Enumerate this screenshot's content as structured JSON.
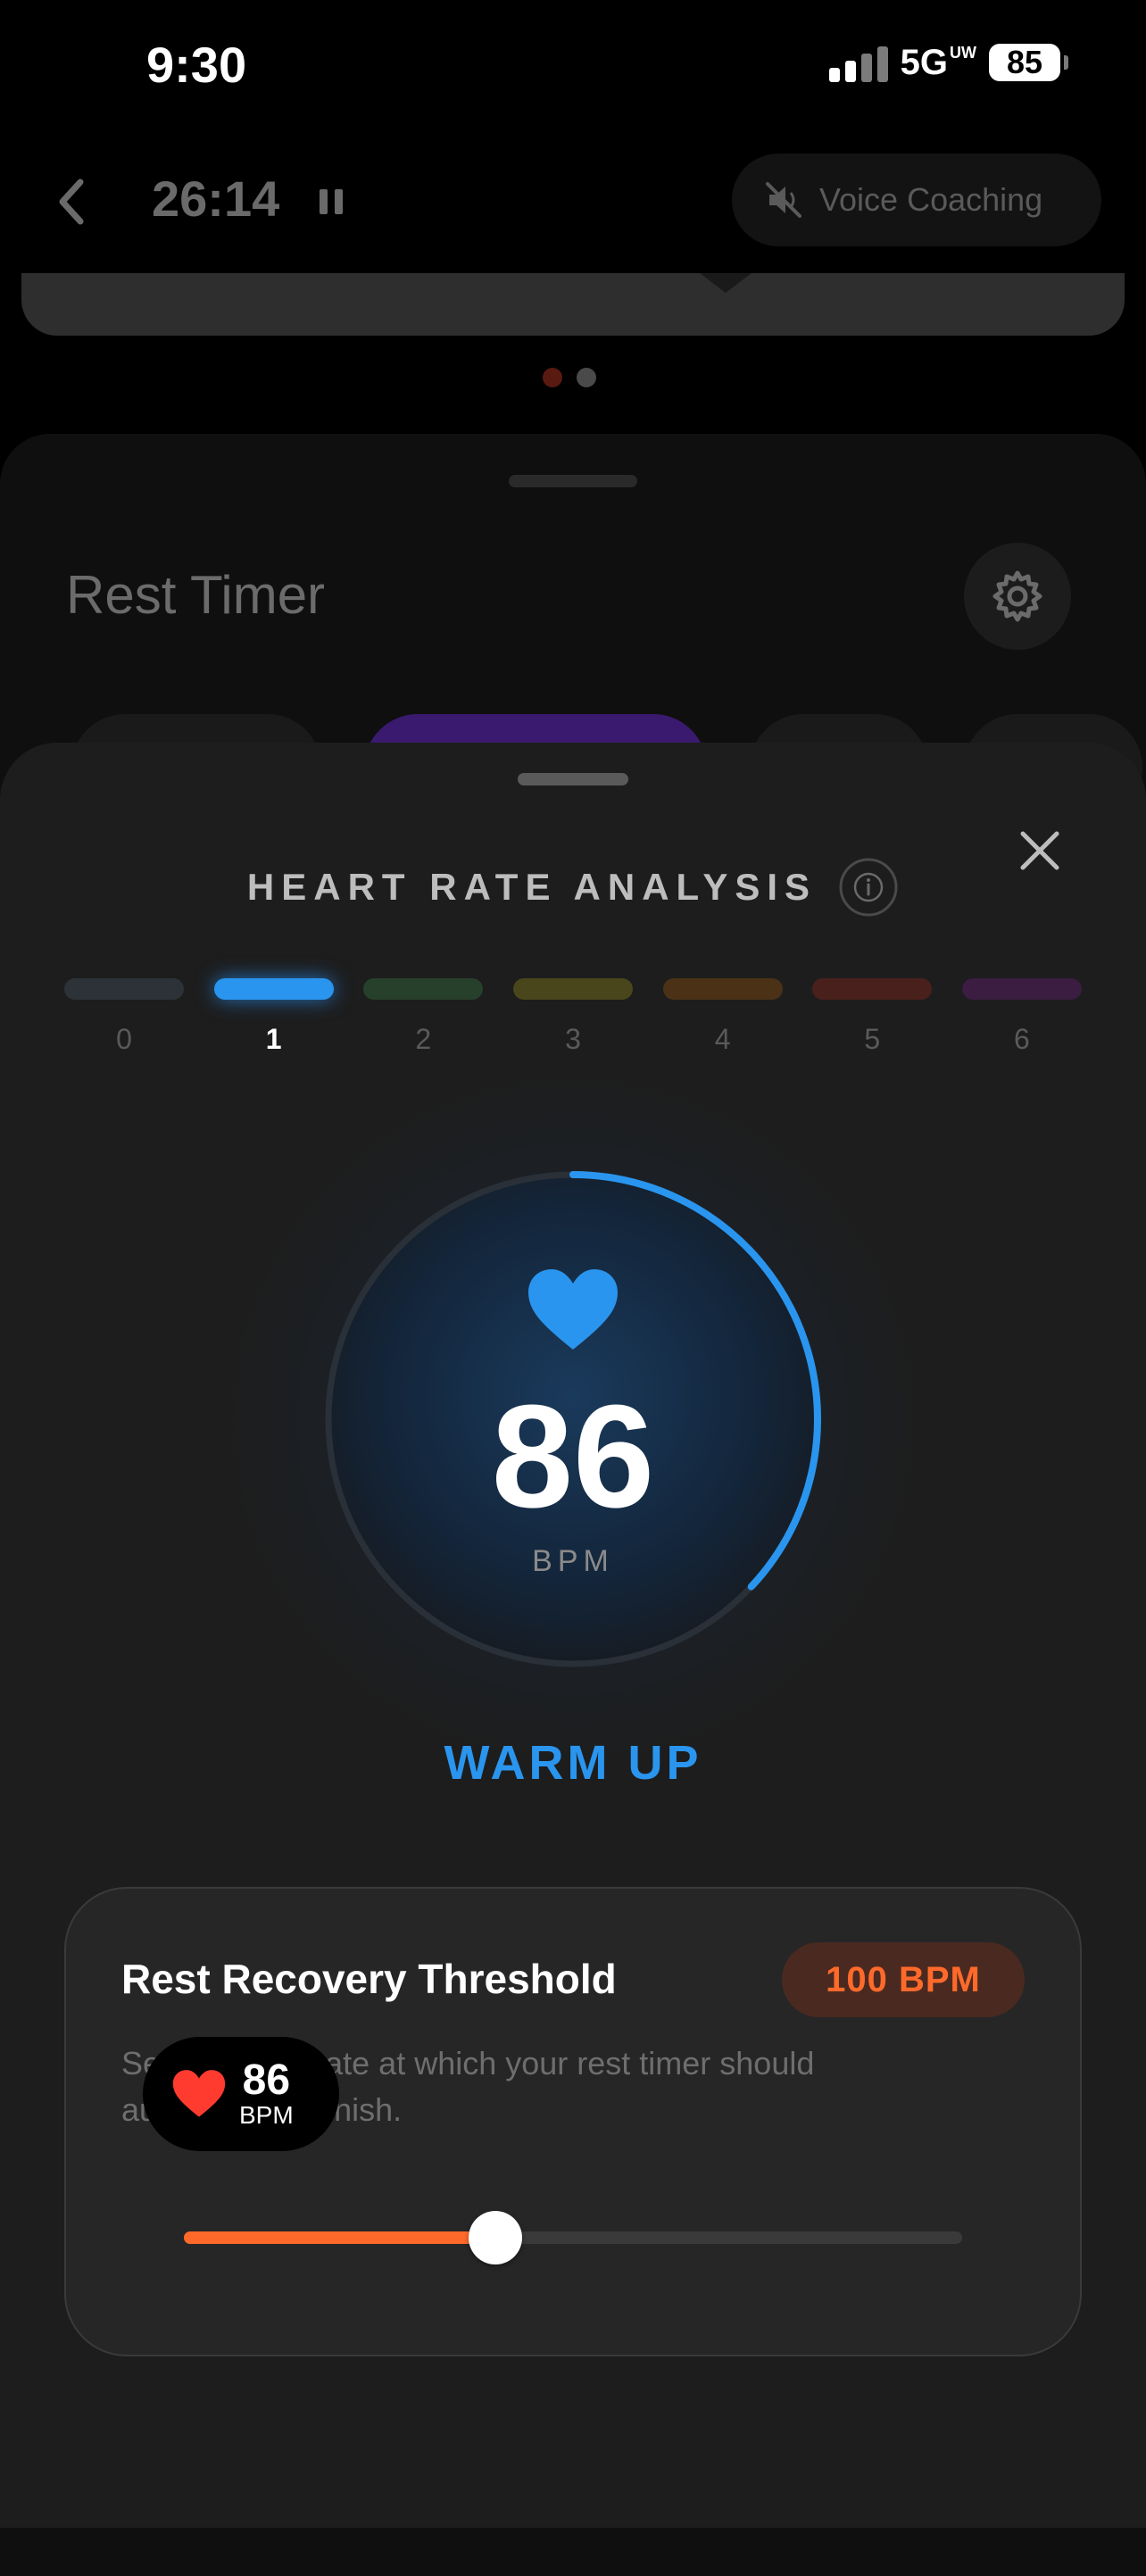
{
  "status_bar": {
    "time": "9:30",
    "network": "5G",
    "network_suffix": "UW",
    "battery": "85"
  },
  "header": {
    "elapsed": "26:14",
    "voice_coaching_label": "Voice Coaching"
  },
  "back_sheet": {
    "title": "Rest Timer"
  },
  "heart_rate_sheet": {
    "title": "HEART RATE ANALYSIS",
    "zones": [
      {
        "label": "0",
        "color": "#2c3238"
      },
      {
        "label": "1",
        "color": "#2a95ee",
        "active": true
      },
      {
        "label": "2",
        "color": "#27402b"
      },
      {
        "label": "3",
        "color": "#4a461c"
      },
      {
        "label": "4",
        "color": "#4b3216"
      },
      {
        "label": "5",
        "color": "#4a201c"
      },
      {
        "label": "6",
        "color": "#3a1d40"
      }
    ],
    "current_bpm": "86",
    "bpm_unit": "BPM",
    "zone_name": "WARM UP",
    "gauge_progress": 0.37
  },
  "threshold_card": {
    "title": "Rest Recovery Threshold",
    "badge": "100 BPM",
    "description": "Set the heart rate at which your rest timer should automatically finish.",
    "slider_value": 0.4
  },
  "mini_hr": {
    "value": "86",
    "unit": "BPM"
  },
  "colors": {
    "accent_blue": "#2a95ee",
    "accent_orange": "#ff6a2b",
    "heart_red": "#ff3b30"
  }
}
